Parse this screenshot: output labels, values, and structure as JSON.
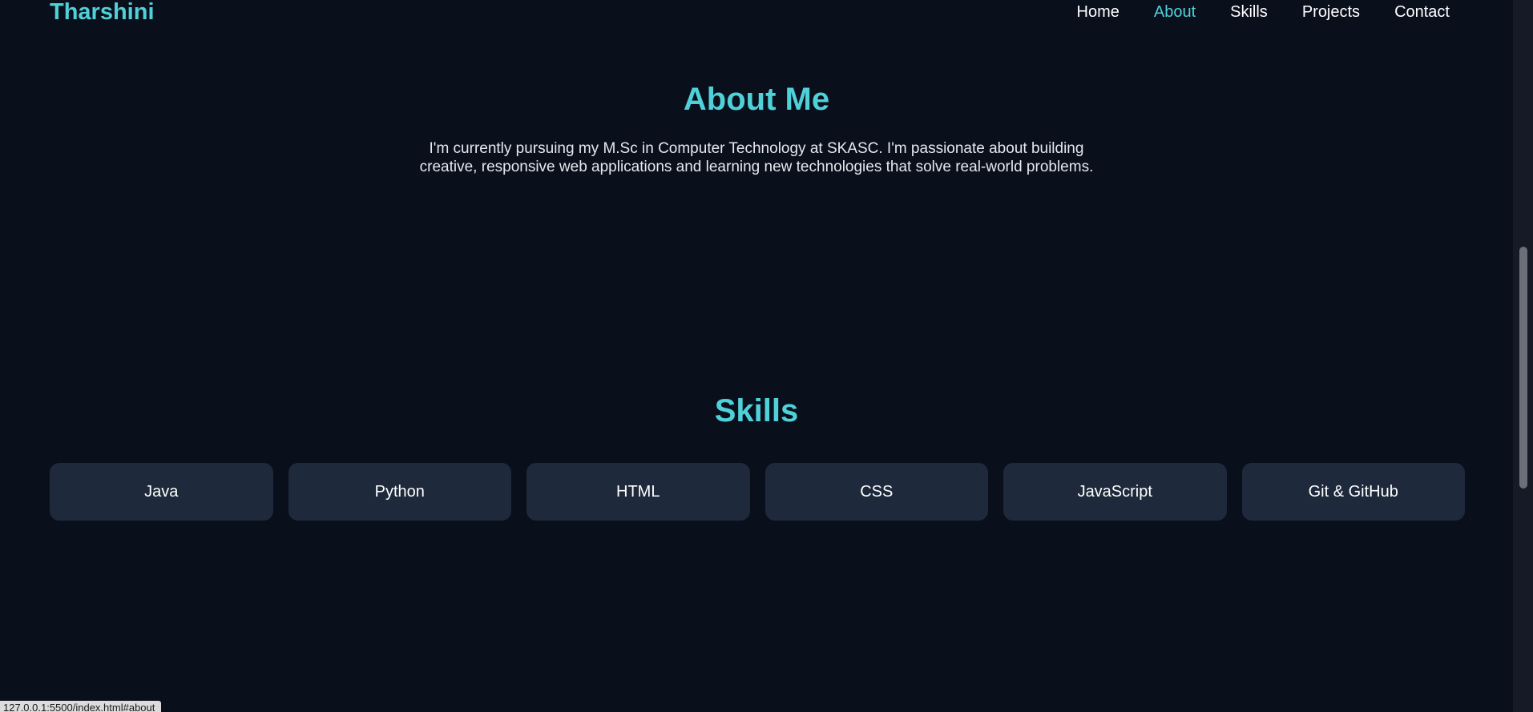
{
  "header": {
    "brand": "Tharshini",
    "nav": [
      {
        "label": "Home",
        "active": false
      },
      {
        "label": "About",
        "active": true
      },
      {
        "label": "Skills",
        "active": false
      },
      {
        "label": "Projects",
        "active": false
      },
      {
        "label": "Contact",
        "active": false
      }
    ]
  },
  "about": {
    "title": "About Me",
    "text": "I'm currently pursuing my M.Sc in Computer Technology at SKASC. I'm passionate about building creative, responsive web applications and learning new technologies that solve real-world problems."
  },
  "skills": {
    "title": "Skills",
    "items": [
      "Java",
      "Python",
      "HTML",
      "CSS",
      "JavaScript",
      "Git & GitHub"
    ]
  },
  "status_bar": {
    "url": "127.0.0.1:5500/index.html#about"
  },
  "colors": {
    "accent": "#4fd1d9",
    "background": "#0a0f1c",
    "card": "#1e293b"
  }
}
